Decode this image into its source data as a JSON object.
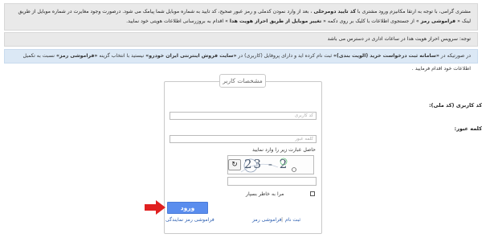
{
  "notices": {
    "main_pre": "مشتری گرامی، با توجه به ارتقا مکانیزم ورود مشتری با ",
    "main_bold1": "کد تایید دومرحلی",
    "main_mid": " ، بعد از وارد نمودن کدملی و رمز عبور صحیح، کد تایید به شماره موبایل شما پیامک می شود. درصورت وجود مغایرت در شماره موبایل از طریق لینک « ",
    "main_bold2": "فراموشی رمز",
    "main_line2_pre": " » از جستجوی اطلاعات با کلیک بر روی دکمه « ",
    "main_bold3": "تغییر موبایل از طریق احراز هویت هدا",
    "main_line2_post": " » اقدام به بروزرسانی اطلاعات هویتی خود نمایید.",
    "note": "توجه: سرویس احراز هویت هدا در ساعات اداری در دسترس می باشد",
    "info_pre": "در صورتیکه در ",
    "info_bold1": "«سامانه ثبت درخواست خرید (الویت بندی)»",
    "info_mid": " ثبت نام کرده اید و دارای پروفایل (کاربری) در ",
    "info_bold2": "«سایت فروش اینترنتی ایران خودرو»",
    "info_mid2": " نیستید با انتخاب گزینه ",
    "info_bold3": "«فراموشی رمز»",
    "info_post": " نسبت به تکمیل اطلاعات خود اقدام فرمایید ."
  },
  "form": {
    "legend": "مشخصات کاربر",
    "username_label": "کد کاربری (کد ملی):",
    "username_placeholder": "کد کاربری",
    "password_label": "کلمه عبور:",
    "password_placeholder": "کلمه عبور",
    "captcha_hint": "حاصل عبارت زیر را وارد نمایید",
    "captcha_text": "23 - 2",
    "refresh_icon": "↻",
    "remember_label": "مرا به خاطر بسپار",
    "login_label": "ورود"
  },
  "links": {
    "register": "ثبت نام",
    "separator": "|",
    "forgot_password": "فراموشی رمز",
    "forgot_agent_password": "فراموشی رمز نمایندگی"
  },
  "colors": {
    "button": "#5a8dee",
    "arrow": "#e02020",
    "info_bg": "#dbe8f5",
    "notice_bg": "#e9e9e9"
  }
}
